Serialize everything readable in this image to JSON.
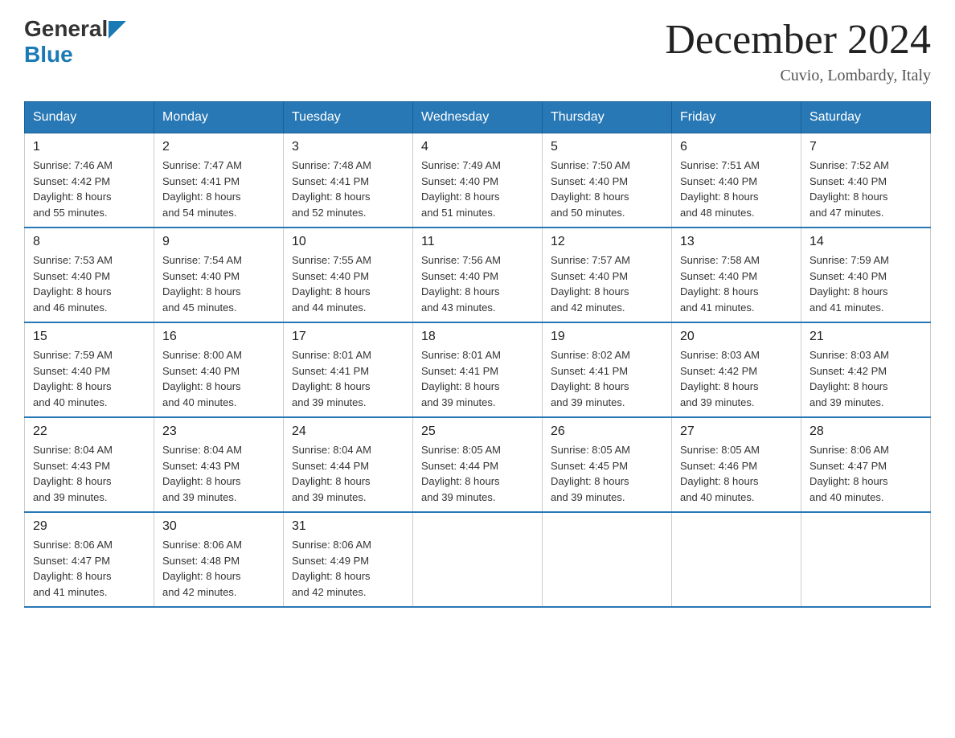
{
  "header": {
    "logo_general": "General",
    "logo_blue": "Blue",
    "title": "December 2024",
    "location": "Cuvio, Lombardy, Italy"
  },
  "days_of_week": [
    "Sunday",
    "Monday",
    "Tuesday",
    "Wednesday",
    "Thursday",
    "Friday",
    "Saturday"
  ],
  "weeks": [
    [
      {
        "day": "1",
        "sunrise": "7:46 AM",
        "sunset": "4:42 PM",
        "daylight": "8 hours and 55 minutes."
      },
      {
        "day": "2",
        "sunrise": "7:47 AM",
        "sunset": "4:41 PM",
        "daylight": "8 hours and 54 minutes."
      },
      {
        "day": "3",
        "sunrise": "7:48 AM",
        "sunset": "4:41 PM",
        "daylight": "8 hours and 52 minutes."
      },
      {
        "day": "4",
        "sunrise": "7:49 AM",
        "sunset": "4:40 PM",
        "daylight": "8 hours and 51 minutes."
      },
      {
        "day": "5",
        "sunrise": "7:50 AM",
        "sunset": "4:40 PM",
        "daylight": "8 hours and 50 minutes."
      },
      {
        "day": "6",
        "sunrise": "7:51 AM",
        "sunset": "4:40 PM",
        "daylight": "8 hours and 48 minutes."
      },
      {
        "day": "7",
        "sunrise": "7:52 AM",
        "sunset": "4:40 PM",
        "daylight": "8 hours and 47 minutes."
      }
    ],
    [
      {
        "day": "8",
        "sunrise": "7:53 AM",
        "sunset": "4:40 PM",
        "daylight": "8 hours and 46 minutes."
      },
      {
        "day": "9",
        "sunrise": "7:54 AM",
        "sunset": "4:40 PM",
        "daylight": "8 hours and 45 minutes."
      },
      {
        "day": "10",
        "sunrise": "7:55 AM",
        "sunset": "4:40 PM",
        "daylight": "8 hours and 44 minutes."
      },
      {
        "day": "11",
        "sunrise": "7:56 AM",
        "sunset": "4:40 PM",
        "daylight": "8 hours and 43 minutes."
      },
      {
        "day": "12",
        "sunrise": "7:57 AM",
        "sunset": "4:40 PM",
        "daylight": "8 hours and 42 minutes."
      },
      {
        "day": "13",
        "sunrise": "7:58 AM",
        "sunset": "4:40 PM",
        "daylight": "8 hours and 41 minutes."
      },
      {
        "day": "14",
        "sunrise": "7:59 AM",
        "sunset": "4:40 PM",
        "daylight": "8 hours and 41 minutes."
      }
    ],
    [
      {
        "day": "15",
        "sunrise": "7:59 AM",
        "sunset": "4:40 PM",
        "daylight": "8 hours and 40 minutes."
      },
      {
        "day": "16",
        "sunrise": "8:00 AM",
        "sunset": "4:40 PM",
        "daylight": "8 hours and 40 minutes."
      },
      {
        "day": "17",
        "sunrise": "8:01 AM",
        "sunset": "4:41 PM",
        "daylight": "8 hours and 39 minutes."
      },
      {
        "day": "18",
        "sunrise": "8:01 AM",
        "sunset": "4:41 PM",
        "daylight": "8 hours and 39 minutes."
      },
      {
        "day": "19",
        "sunrise": "8:02 AM",
        "sunset": "4:41 PM",
        "daylight": "8 hours and 39 minutes."
      },
      {
        "day": "20",
        "sunrise": "8:03 AM",
        "sunset": "4:42 PM",
        "daylight": "8 hours and 39 minutes."
      },
      {
        "day": "21",
        "sunrise": "8:03 AM",
        "sunset": "4:42 PM",
        "daylight": "8 hours and 39 minutes."
      }
    ],
    [
      {
        "day": "22",
        "sunrise": "8:04 AM",
        "sunset": "4:43 PM",
        "daylight": "8 hours and 39 minutes."
      },
      {
        "day": "23",
        "sunrise": "8:04 AM",
        "sunset": "4:43 PM",
        "daylight": "8 hours and 39 minutes."
      },
      {
        "day": "24",
        "sunrise": "8:04 AM",
        "sunset": "4:44 PM",
        "daylight": "8 hours and 39 minutes."
      },
      {
        "day": "25",
        "sunrise": "8:05 AM",
        "sunset": "4:44 PM",
        "daylight": "8 hours and 39 minutes."
      },
      {
        "day": "26",
        "sunrise": "8:05 AM",
        "sunset": "4:45 PM",
        "daylight": "8 hours and 39 minutes."
      },
      {
        "day": "27",
        "sunrise": "8:05 AM",
        "sunset": "4:46 PM",
        "daylight": "8 hours and 40 minutes."
      },
      {
        "day": "28",
        "sunrise": "8:06 AM",
        "sunset": "4:47 PM",
        "daylight": "8 hours and 40 minutes."
      }
    ],
    [
      {
        "day": "29",
        "sunrise": "8:06 AM",
        "sunset": "4:47 PM",
        "daylight": "8 hours and 41 minutes."
      },
      {
        "day": "30",
        "sunrise": "8:06 AM",
        "sunset": "4:48 PM",
        "daylight": "8 hours and 42 minutes."
      },
      {
        "day": "31",
        "sunrise": "8:06 AM",
        "sunset": "4:49 PM",
        "daylight": "8 hours and 42 minutes."
      },
      null,
      null,
      null,
      null
    ]
  ],
  "labels": {
    "sunrise": "Sunrise:",
    "sunset": "Sunset:",
    "daylight": "Daylight:"
  }
}
